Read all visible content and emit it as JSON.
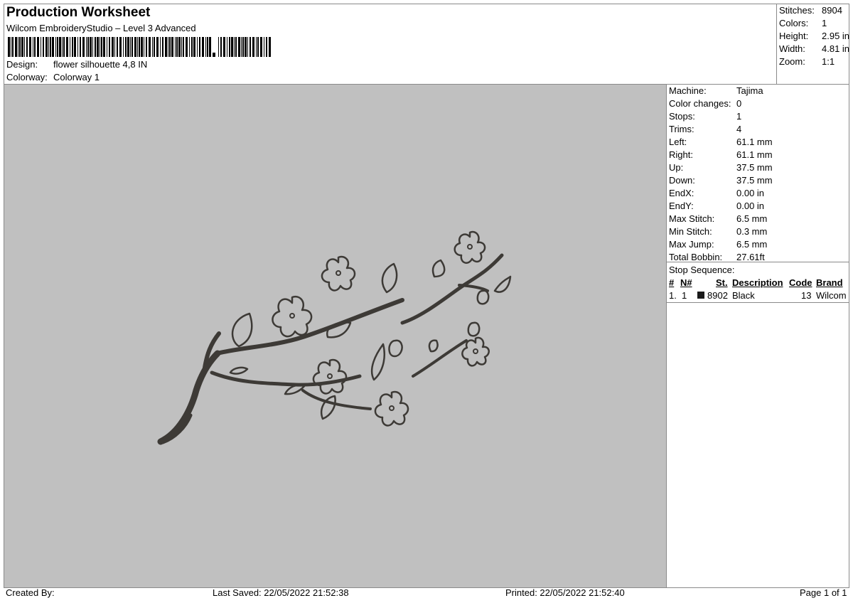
{
  "header": {
    "title": "Production Worksheet",
    "subtitle": "Wilcom EmbroideryStudio – Level 3 Advanced",
    "design_label": "Design:",
    "design_value": "flower silhouette 4,8 IN",
    "colorway_label": "Colorway:",
    "colorway_value": "Colorway 1"
  },
  "stats": [
    {
      "label": "Stitches:",
      "value": "8904"
    },
    {
      "label": "Colors:",
      "value": "1"
    },
    {
      "label": "Height:",
      "value": "2.95 in"
    },
    {
      "label": "Width:",
      "value": "4.81 in"
    },
    {
      "label": "Zoom:",
      "value": "1:1"
    }
  ],
  "machine_info": [
    {
      "label": "Machine:",
      "value": "Tajima"
    },
    {
      "label": "Color changes:",
      "value": "0"
    },
    {
      "label": "Stops:",
      "value": "1"
    },
    {
      "label": "Trims:",
      "value": "4"
    },
    {
      "label": "Left:",
      "value": "61.1 mm"
    },
    {
      "label": "Right:",
      "value": "61.1 mm"
    },
    {
      "label": "Up:",
      "value": "37.5 mm"
    },
    {
      "label": "Down:",
      "value": "37.5 mm"
    },
    {
      "label": "EndX:",
      "value": "0.00 in"
    },
    {
      "label": "EndY:",
      "value": "0.00 in"
    },
    {
      "label": "Max Stitch:",
      "value": "6.5 mm"
    },
    {
      "label": "Min Stitch:",
      "value": "0.3 mm"
    },
    {
      "label": "Max Jump:",
      "value": "6.5 mm"
    },
    {
      "label": "Total Bobbin:",
      "value": "27.61ft"
    }
  ],
  "stop_sequence": {
    "title": "Stop Sequence:",
    "columns": [
      "#",
      "N#",
      "St.",
      "Description",
      "Code",
      "Brand"
    ],
    "rows": [
      {
        "index": "1.",
        "n": "1",
        "stitches": "8902",
        "description": "Black",
        "code": "13",
        "brand": "Wilcom",
        "color": "#1a1a1a"
      }
    ]
  },
  "footer": {
    "created_by": "Created By:",
    "last_saved": "Last Saved: 22/05/2022 21:52:38",
    "printed": "Printed: 22/05/2022 21:52:40",
    "page": "Page 1 of 1"
  },
  "colors": {
    "canvas_background": "#c0c0c0",
    "thread": "#3d3a36"
  }
}
